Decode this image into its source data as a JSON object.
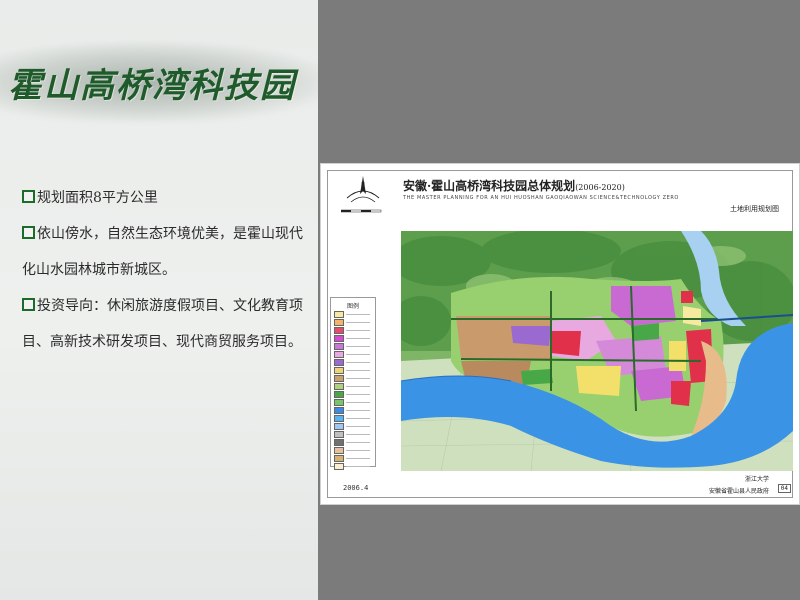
{
  "slide": {
    "title": "霍山高桥湾科技园",
    "bullets": [
      "规划面积8平方公里",
      "依山傍水，自然生态环境优美，是霍山现代化山水园林城市新城区。",
      "投资导向：休闲旅游度假项目、文化教育项目、高新技术研发项目、现代商贸服务项目。"
    ]
  },
  "map": {
    "title_cn": "安徽·霍山高桥湾科技园总体规划",
    "title_years": "(2006-2020)",
    "title_en": "THE MASTER PLANNING FOR AN HUI HUOSHAN GAOQIAOWAN SCIENCE&TECHNOLOGY ZERO",
    "subtitle": "土地利用规划图",
    "legend_title": "图例",
    "date": "2006.4",
    "credit_line1": "浙江大学",
    "credit_line2": "安徽省霍山县人民政府",
    "page": "04",
    "legend_colors": [
      "#f7e9a0",
      "#f2b36b",
      "#e84a6a",
      "#d44ad0",
      "#c878d8",
      "#e8a8e0",
      "#9b6ad0",
      "#f0d27a",
      "#c9a26b",
      "#b0d080",
      "#48a848",
      "#7cc46c",
      "#3c8ae8",
      "#58b4f0",
      "#a0c8f0",
      "#c0c0c0",
      "#707070",
      "#e8c0a0",
      "#d8b070",
      "#f8f0d0"
    ],
    "colors": {
      "mountain": "#6eaa5a",
      "forest": "#3f8f3a",
      "river": "#3a93e4",
      "residential": "#c99a6b",
      "commercial": "#e0304a",
      "industrial": "#c86ad2",
      "greenbelt": "#98d070",
      "farmland": "#cfe2c0",
      "education": "#f2e06a"
    }
  }
}
